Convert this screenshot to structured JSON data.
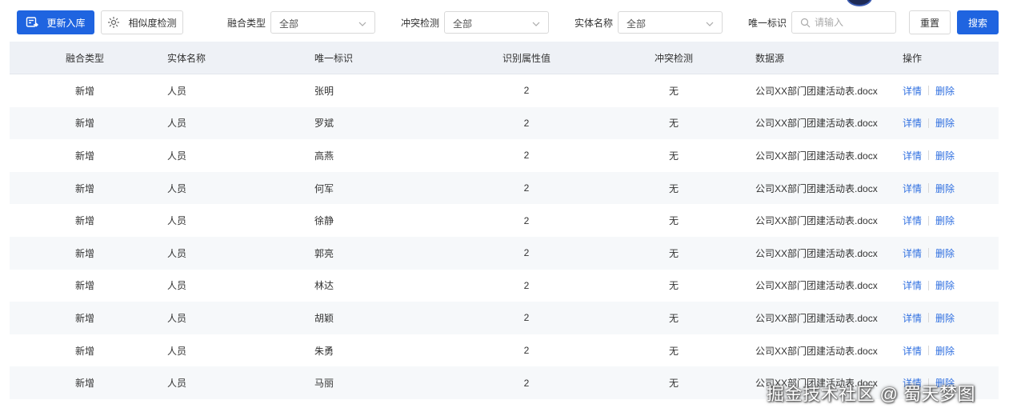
{
  "toolbar": {
    "import_label": "更新入库",
    "similarity_label": "相似度检测",
    "reset_label": "重置",
    "search_label": "搜索"
  },
  "filters": {
    "fusion_type": {
      "label": "融合类型",
      "value": "全部"
    },
    "conflict": {
      "label": "冲突检测",
      "value": "全部"
    },
    "entity_name": {
      "label": "实体名称",
      "value": "全部"
    },
    "unique_id": {
      "label": "唯一标识",
      "placeholder": "请输入"
    }
  },
  "table": {
    "columns": [
      "融合类型",
      "实体名称",
      "唯一标识",
      "识别属性值",
      "冲突检测",
      "数据源",
      "操作"
    ],
    "actions": {
      "detail": "详情",
      "delete": "删除"
    },
    "rows": [
      [
        "新增",
        "人员",
        "张明",
        "2",
        "无",
        "公司XX部门团建活动表.docx"
      ],
      [
        "新增",
        "人员",
        "罗斌",
        "2",
        "无",
        "公司XX部门团建活动表.docx"
      ],
      [
        "新增",
        "人员",
        "高燕",
        "2",
        "无",
        "公司XX部门团建活动表.docx"
      ],
      [
        "新增",
        "人员",
        "何军",
        "2",
        "无",
        "公司XX部门团建活动表.docx"
      ],
      [
        "新增",
        "人员",
        "徐静",
        "2",
        "无",
        "公司XX部门团建活动表.docx"
      ],
      [
        "新增",
        "人员",
        "郭亮",
        "2",
        "无",
        "公司XX部门团建活动表.docx"
      ],
      [
        "新增",
        "人员",
        "林达",
        "2",
        "无",
        "公司XX部门团建活动表.docx"
      ],
      [
        "新增",
        "人员",
        "胡颖",
        "2",
        "无",
        "公司XX部门团建活动表.docx"
      ],
      [
        "新增",
        "人员",
        "朱勇",
        "2",
        "无",
        "公司XX部门团建活动表.docx"
      ],
      [
        "新增",
        "人员",
        "马丽",
        "2",
        "无",
        "公司XX部门团建活动表.docx"
      ]
    ]
  },
  "watermark": "掘金技术社区 @ 蜀天梦图"
}
